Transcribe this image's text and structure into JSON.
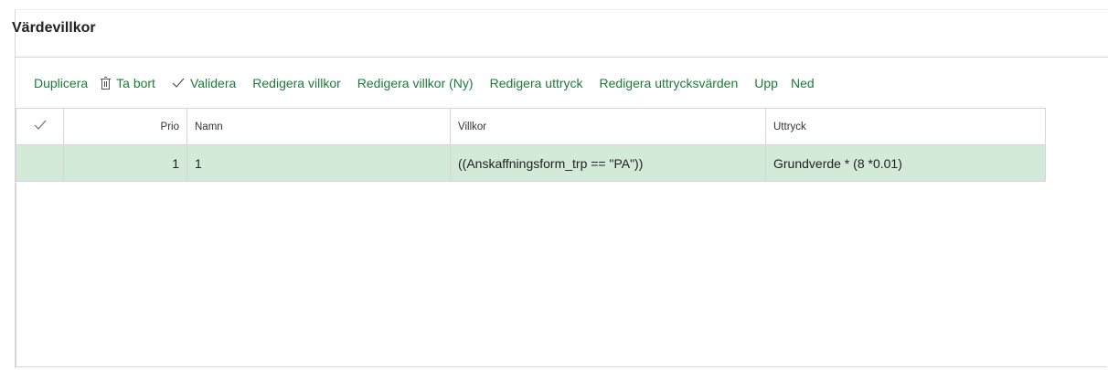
{
  "section": {
    "title": "Värdevillkor"
  },
  "toolbar": {
    "duplicate": "Duplicera",
    "delete": "Ta bort",
    "validate": "Validera",
    "edit_conditions": "Redigera villkor",
    "edit_conditions_new": "Redigera villkor (Ny)",
    "edit_expression": "Redigera uttryck",
    "edit_expression_values": "Redigera uttrycksvärden",
    "up": "Upp",
    "down": "Ned"
  },
  "grid": {
    "columns": {
      "prio": "Prio",
      "name": "Namn",
      "conditions": "Villkor",
      "expression": "Uttryck"
    },
    "rows": [
      {
        "prio": "1",
        "name": "1",
        "conditions": "((Anskaffningsform_trp == \"PA\"))",
        "expression": "Grundverde * (8 *0.01)"
      }
    ]
  },
  "colors": {
    "accent": "#1d7b3a",
    "selected_row": "#d3ead9",
    "border": "#d6d6d6"
  },
  "icons": {
    "delete": "trash-icon",
    "validate": "check-icon",
    "select_all": "check-icon"
  }
}
